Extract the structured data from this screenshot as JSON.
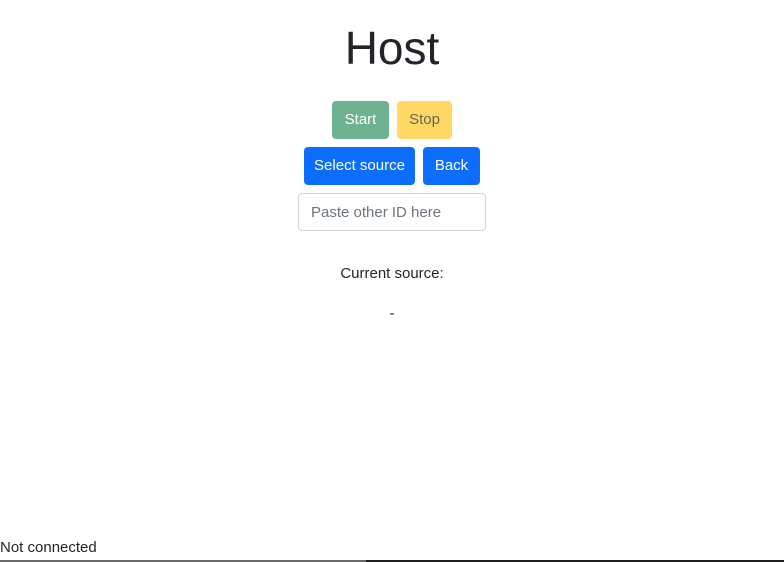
{
  "header": {
    "title": "Host"
  },
  "controls": {
    "start_label": "Start",
    "stop_label": "Stop",
    "select_source_label": "Select source",
    "back_label": "Back",
    "id_input": {
      "value": "",
      "placeholder": "Paste other ID here"
    }
  },
  "source": {
    "label": "Current source:",
    "value": "-"
  },
  "status": {
    "text": "Not connected"
  },
  "colors": {
    "start": "#6db391",
    "stop": "#ffd866",
    "primary": "#0d6efd"
  }
}
